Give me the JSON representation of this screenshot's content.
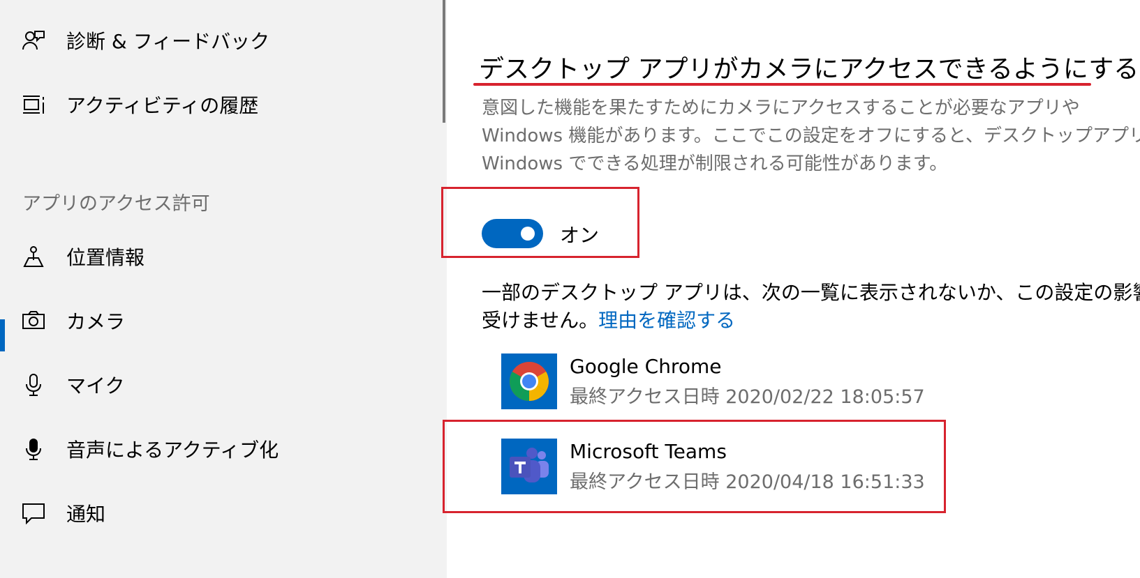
{
  "sidebar": {
    "items_top": [
      {
        "label": "診断 & フィードバック",
        "icon": "feedback-icon"
      },
      {
        "label": "アクティビティの履歴",
        "icon": "timeline-icon"
      }
    ],
    "section_heading": "アプリのアクセス許可",
    "items": [
      {
        "label": "位置情報",
        "icon": "location-icon"
      },
      {
        "label": "カメラ",
        "icon": "camera-icon",
        "selected": true
      },
      {
        "label": "マイク",
        "icon": "microphone-icon"
      },
      {
        "label": "音声によるアクティブ化",
        "icon": "voice-activation-icon"
      },
      {
        "label": "通知",
        "icon": "notification-icon"
      }
    ]
  },
  "main": {
    "title": "デスクトップ アプリがカメラにアクセスできるようにする",
    "description_lines": [
      "意図した機能を果たすためにカメラにアクセスすることが必要なアプリや",
      "Windows 機能があります。ここでこの設定をオフにすると、デスクトップアプリと",
      "Windows でできる処理が制限される可能性があります。"
    ],
    "toggle": {
      "state": "on",
      "label": "オン"
    },
    "note_line1": "一部のデスクトップ アプリは、次の一覧に表示されないか、この設定の影響を",
    "note_line2": "受けません。",
    "note_link": "理由を確認する",
    "apps": [
      {
        "name": "Google Chrome",
        "last_access": "最終アクセス日時 2020/02/22 18:05:57",
        "icon": "chrome-icon"
      },
      {
        "name": "Microsoft Teams",
        "last_access": "最終アクセス日時 2020/04/18 16:51:33",
        "icon": "teams-icon"
      }
    ]
  },
  "colors": {
    "accent": "#0067c0",
    "highlight_red": "#d7232e",
    "sidebar_bg": "#f2f2f2",
    "secondary_text": "#6d6d6d",
    "app_tile_bg": "#0067c0"
  }
}
